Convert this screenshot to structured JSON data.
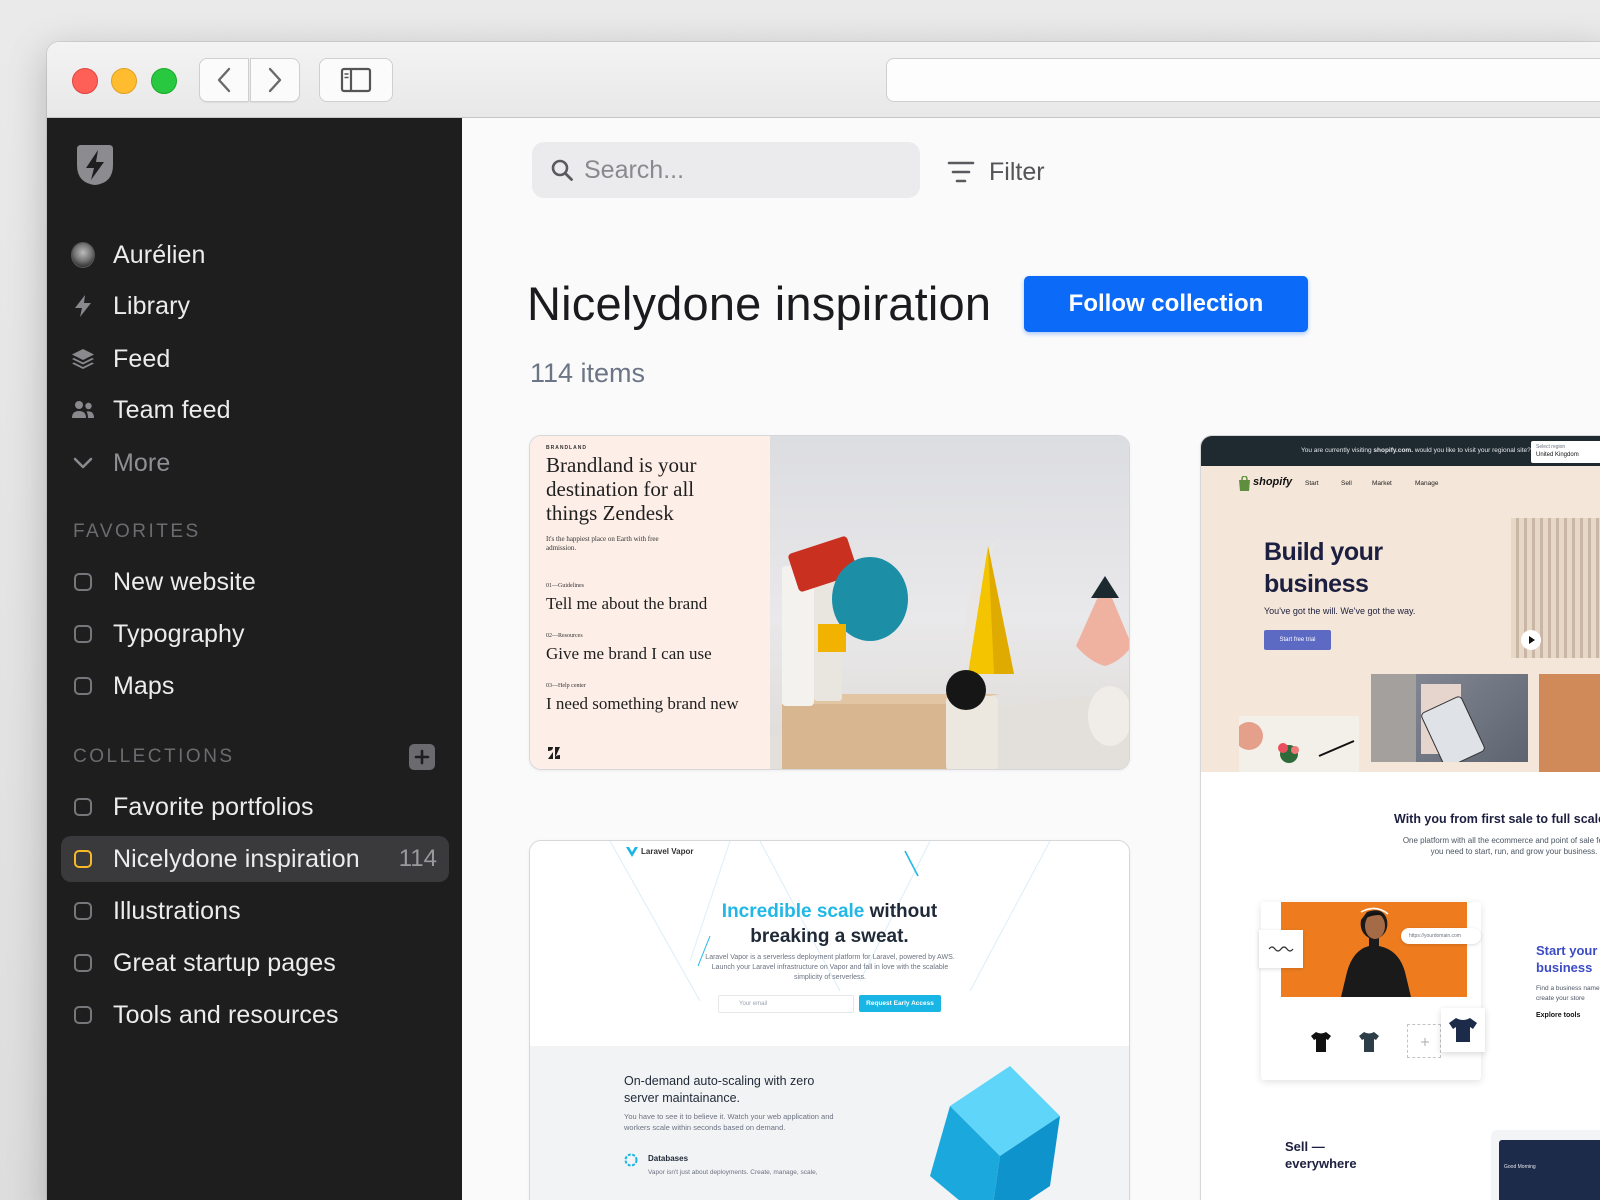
{
  "sidebar": {
    "user": "Aurélien",
    "nav": [
      {
        "label": "Library"
      },
      {
        "label": "Feed"
      },
      {
        "label": "Team feed"
      },
      {
        "label": "More"
      }
    ],
    "favorites_heading": "FAVORITES",
    "favorites": [
      {
        "label": "New website"
      },
      {
        "label": "Typography"
      },
      {
        "label": "Maps"
      }
    ],
    "collections_heading": "COLLECTIONS",
    "collections": [
      {
        "label": "Favorite portfolios"
      },
      {
        "label": "Nicelydone inspiration",
        "count": "114",
        "active": true
      },
      {
        "label": "Illustrations"
      },
      {
        "label": "Great startup pages"
      },
      {
        "label": "Tools and resources"
      }
    ]
  },
  "main": {
    "search_placeholder": "Search...",
    "filter_label": "Filter",
    "title": "Nicelydone inspiration",
    "follow_label": "Follow collection",
    "item_count": "114 items",
    "accent": "#0b6af7"
  },
  "cards": {
    "brandland": {
      "eyebrow": "BRANDLAND",
      "headline": "Brandland is your destination for all things Zendesk",
      "sub": "It's the happiest place on Earth with free admission.",
      "links": [
        {
          "num": "01—Guidelines",
          "text": "Tell me about the brand"
        },
        {
          "num": "02—Resources",
          "text": "Give me brand I can use"
        },
        {
          "num": "03—Help center",
          "text": "I need something brand new"
        }
      ]
    },
    "vapor": {
      "brand": "Laravel Vapor",
      "headline_accent": "Incredible scale",
      "headline_rest": "without",
      "headline_line2": "breaking a sweat.",
      "desc": "Laravel Vapor is a serverless deployment platform for Laravel, powered by AWS. Launch your Laravel infrastructure on Vapor and fall in love with the scalable simplicity of serverless.",
      "email_placeholder": "Your email",
      "cta": "Request Early Access",
      "section_title": "On-demand auto-scaling with zero server maintainance.",
      "section_text": "You have to see it to believe it. Watch your web application and workers scale within seconds based on demand.",
      "feature_title": "Databases",
      "feature_text": "Vapor isn't just about deployments. Create, manage, scale,"
    },
    "shopify": {
      "banner_prefix": "You are currently visiting",
      "banner_domain": "shopify.com.",
      "banner_suffix": "would you like to visit your regional site?",
      "region_label": "Select region",
      "region_value": "United Kingdom",
      "brand": "shopify",
      "menu": [
        "Start",
        "Sell",
        "Market",
        "Manage"
      ],
      "headline": "Build your business",
      "sub": "You've got the will. We've got the way.",
      "cta": "Start free trial",
      "section_title": "With you from first sale to full scale",
      "section_text": "One platform with all the ecommerce and point of sale features you need to start, run, and grow your business.",
      "url_chip": "https://yourdomain.com",
      "side_title": "Start your business",
      "side_text": "Find a business name and create your store",
      "side_link": "Explore tools",
      "sell_heading": "Sell — everywhere",
      "mini_app_text": "Good Morning"
    }
  }
}
